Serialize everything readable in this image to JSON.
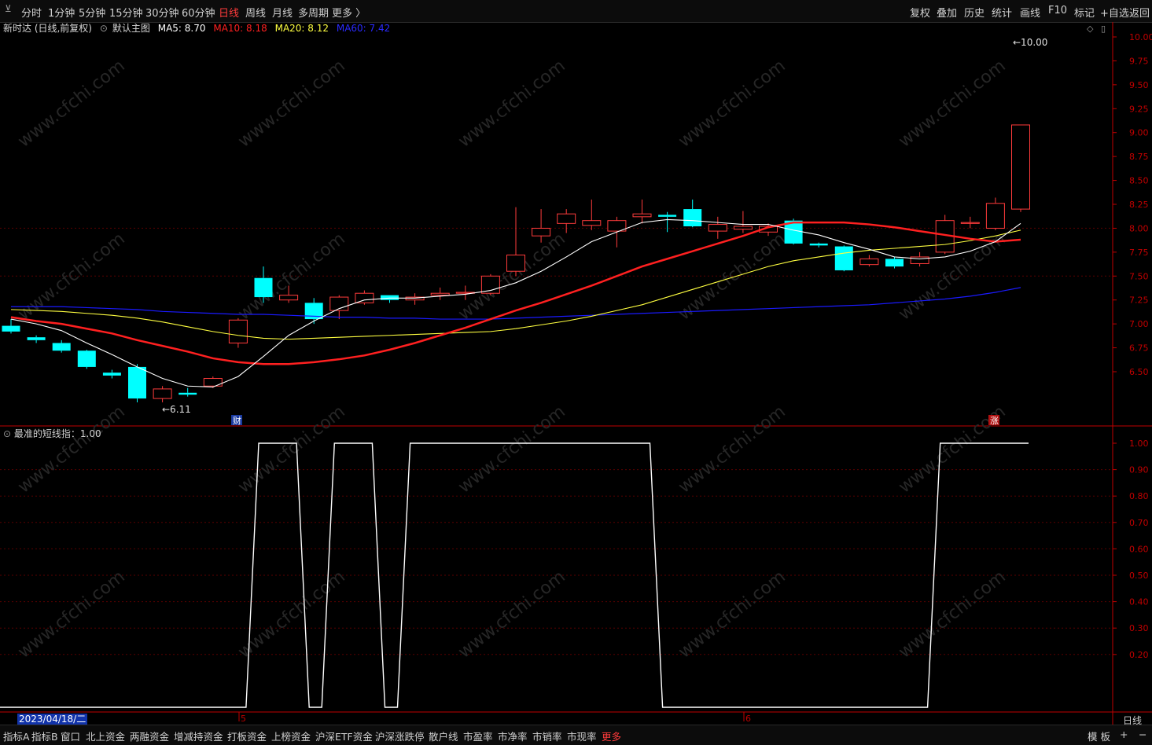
{
  "topbar": {
    "periods": [
      "分时",
      "1分钟",
      "5分钟",
      "15分钟",
      "30分钟",
      "60分钟",
      "日线",
      "周线",
      "月线",
      "多周期",
      "更多 〉"
    ],
    "active_period": "日线",
    "right_buttons": [
      "复权",
      "叠加",
      "历史",
      "统计",
      "画线",
      "F10",
      "标记",
      "+自选",
      "返回"
    ]
  },
  "main_legend": {
    "stock": "新时达 (日线,前复权)",
    "template": "默认主图",
    "ma5": "MA5: 8.70",
    "ma10": "MA10: 8.18",
    "ma20": "MA20: 8.12",
    "ma60": "MA60: 7.42"
  },
  "colors": {
    "up": "#ff3b3b",
    "down": "#00ffff",
    "ma5": "#ffffff",
    "ma10": "#ff2020",
    "ma20": "#ffff40",
    "ma60": "#1a1aff",
    "axis": "#c00000"
  },
  "annotations": {
    "low_label": "6.11",
    "high_label": "10.00",
    "event_cai": "财",
    "event_zhang": "涨"
  },
  "price_axis": [
    "10.00",
    "9.75",
    "9.50",
    "9.25",
    "9.00",
    "8.75",
    "8.50",
    "8.25",
    "8.00",
    "7.75",
    "7.50",
    "7.25",
    "7.00",
    "6.75",
    "6.50"
  ],
  "indicator": {
    "title": "最准的短线指：1.00",
    "axis": [
      "1.00",
      "0.90",
      "0.80",
      "0.70",
      "0.60",
      "0.50",
      "0.40",
      "0.30",
      "0.20"
    ]
  },
  "time_axis": {
    "date": "2023/04/18/二",
    "month_marks": [
      "5",
      "6"
    ],
    "period": "日线"
  },
  "bottombar": {
    "tabs": [
      "指标A",
      "指标B",
      "窗口",
      "北上资金",
      "两融资金",
      "增减持资金",
      "打板资金",
      "上榜资金",
      "沪深ETF资金",
      "沪深涨跌停",
      "散户线",
      "市盈率",
      "市净率",
      "市销率",
      "市现率",
      "更多"
    ],
    "right": [
      "模 板",
      "+",
      "−"
    ]
  },
  "watermark": "www.cfchi.com",
  "chart_data": {
    "type": "candlestick",
    "ohlc": [
      [
        6.98,
        7.05,
        6.9,
        6.92
      ],
      [
        6.86,
        6.88,
        6.8,
        6.83
      ],
      [
        6.8,
        6.83,
        6.7,
        6.72
      ],
      [
        6.72,
        6.73,
        6.53,
        6.55
      ],
      [
        6.49,
        6.52,
        6.43,
        6.46
      ],
      [
        6.55,
        6.58,
        6.18,
        6.22
      ],
      [
        6.22,
        6.35,
        6.18,
        6.32
      ],
      [
        6.28,
        6.33,
        6.24,
        6.26
      ],
      [
        6.35,
        6.45,
        6.33,
        6.43
      ],
      [
        6.8,
        7.06,
        6.75,
        7.04
      ],
      [
        7.48,
        7.6,
        7.22,
        7.28
      ],
      [
        7.25,
        7.4,
        7.22,
        7.3
      ],
      [
        7.22,
        7.27,
        7.0,
        7.05
      ],
      [
        7.14,
        7.3,
        7.05,
        7.28
      ],
      [
        7.22,
        7.35,
        7.2,
        7.32
      ],
      [
        7.3,
        7.3,
        7.22,
        7.25
      ],
      [
        7.25,
        7.32,
        7.2,
        7.28
      ],
      [
        7.3,
        7.38,
        7.25,
        7.32
      ],
      [
        7.32,
        7.4,
        7.25,
        7.33
      ],
      [
        7.32,
        7.52,
        7.3,
        7.5
      ],
      [
        7.55,
        8.22,
        7.5,
        7.72
      ],
      [
        7.92,
        8.2,
        7.85,
        8.0
      ],
      [
        8.05,
        8.2,
        7.95,
        8.15
      ],
      [
        8.03,
        8.3,
        7.98,
        8.08
      ],
      [
        7.97,
        8.12,
        7.8,
        8.08
      ],
      [
        8.12,
        8.3,
        8.05,
        8.15
      ],
      [
        8.14,
        8.17,
        7.96,
        8.12
      ],
      [
        8.2,
        8.3,
        8.01,
        8.02
      ],
      [
        7.97,
        8.12,
        7.89,
        8.04
      ],
      [
        7.99,
        8.18,
        7.95,
        8.02
      ],
      [
        7.96,
        8.05,
        7.92,
        8.02
      ],
      [
        8.08,
        8.1,
        7.83,
        7.84
      ],
      [
        7.84,
        7.85,
        7.8,
        7.82
      ],
      [
        7.81,
        7.82,
        7.55,
        7.56
      ],
      [
        7.62,
        7.72,
        7.6,
        7.68
      ],
      [
        7.68,
        7.7,
        7.58,
        7.6
      ],
      [
        7.63,
        7.75,
        7.6,
        7.7
      ],
      [
        7.75,
        8.14,
        7.73,
        8.08
      ],
      [
        8.05,
        8.12,
        8.0,
        8.06
      ],
      [
        8.0,
        8.32,
        7.98,
        8.26
      ],
      [
        8.2,
        9.08,
        8.17,
        9.08
      ]
    ],
    "ma5": [
      7.05,
      7.0,
      6.93,
      6.8,
      6.68,
      6.55,
      6.43,
      6.35,
      6.34,
      6.45,
      6.66,
      6.88,
      7.03,
      7.16,
      7.25,
      7.27,
      7.27,
      7.29,
      7.31,
      7.35,
      7.43,
      7.55,
      7.7,
      7.86,
      7.96,
      8.06,
      8.09,
      8.08,
      8.06,
      8.04,
      8.04,
      7.98,
      7.93,
      7.85,
      7.78,
      7.7,
      7.68,
      7.7,
      7.76,
      7.86,
      8.05
    ],
    "ma10": [
      7.07,
      7.03,
      7.0,
      6.95,
      6.9,
      6.83,
      6.77,
      6.71,
      6.64,
      6.6,
      6.58,
      6.58,
      6.6,
      6.63,
      6.67,
      6.73,
      6.8,
      6.88,
      6.96,
      7.05,
      7.14,
      7.22,
      7.31,
      7.4,
      7.5,
      7.6,
      7.68,
      7.76,
      7.84,
      7.92,
      8.01,
      8.06,
      8.06,
      8.06,
      8.04,
      8.01,
      7.97,
      7.93,
      7.89,
      7.86,
      7.88
    ],
    "ma20": [
      7.15,
      7.14,
      7.13,
      7.11,
      7.09,
      7.06,
      7.02,
      6.97,
      6.92,
      6.88,
      6.85,
      6.84,
      6.85,
      6.86,
      6.87,
      6.88,
      6.89,
      6.9,
      6.91,
      6.92,
      6.95,
      6.99,
      7.03,
      7.08,
      7.14,
      7.2,
      7.28,
      7.36,
      7.44,
      7.52,
      7.6,
      7.66,
      7.7,
      7.74,
      7.77,
      7.79,
      7.81,
      7.83,
      7.87,
      7.92,
      7.98
    ],
    "ma60": [
      7.18,
      7.18,
      7.18,
      7.17,
      7.16,
      7.15,
      7.13,
      7.12,
      7.11,
      7.1,
      7.1,
      7.09,
      7.08,
      7.07,
      7.07,
      7.06,
      7.06,
      7.05,
      7.05,
      7.05,
      7.06,
      7.07,
      7.08,
      7.09,
      7.1,
      7.11,
      7.12,
      7.13,
      7.14,
      7.15,
      7.16,
      7.17,
      7.18,
      7.19,
      7.2,
      7.22,
      7.24,
      7.26,
      7.29,
      7.33,
      7.38
    ],
    "indicator_values": [
      0,
      0,
      0,
      0,
      0,
      0,
      0,
      0,
      0,
      0,
      1,
      1,
      0,
      1,
      1,
      0,
      1,
      1,
      1,
      1,
      1,
      1,
      1,
      1,
      1,
      1,
      0,
      0,
      0,
      0,
      0,
      0,
      0,
      0,
      0,
      0,
      0,
      1,
      1,
      1,
      1
    ],
    "ylim_main": [
      6.0,
      10.3
    ],
    "ylim_indicator": [
      0,
      1.0
    ]
  }
}
